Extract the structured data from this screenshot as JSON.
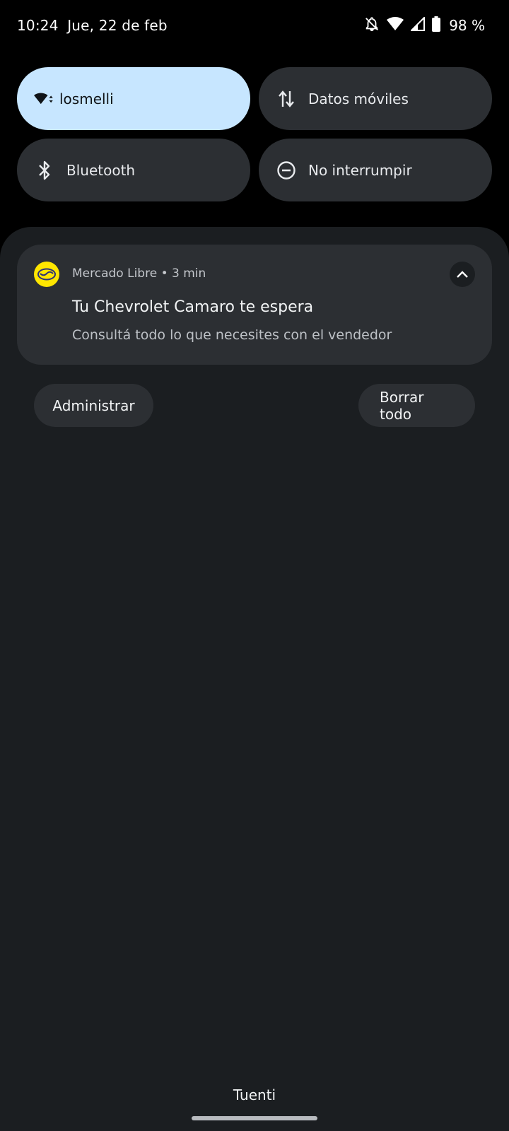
{
  "status_bar": {
    "time": "10:24",
    "date": "Jue, 22 de feb",
    "icons": [
      "notifications-off-icon",
      "wifi-icon",
      "cell-signal-icon",
      "battery-icon"
    ],
    "battery_percent": "98 %"
  },
  "quick_settings": {
    "tiles": [
      {
        "label": "losmelli",
        "icon": "wifi-icon",
        "active": true
      },
      {
        "label": "Datos móviles",
        "icon": "mobile-data-icon",
        "active": false
      },
      {
        "label": "Bluetooth",
        "icon": "bluetooth-icon",
        "active": false
      },
      {
        "label": "No interrumpir",
        "icon": "do-not-disturb-icon",
        "active": false
      }
    ]
  },
  "notification": {
    "app_icon": "mercado-libre-logo",
    "header": "Mercado Libre • 3 min",
    "title": "Tu Chevrolet Camaro te espera",
    "text": "Consultá todo lo que necesites con el vendedor",
    "expand_icon": "chevron-up-icon"
  },
  "actions": {
    "manage_label": "Administrar",
    "clear_all_label": "Borrar todo"
  },
  "footer": {
    "carrier": "Tuenti"
  },
  "colors": {
    "background": "#000000",
    "shade": "#1b1e21",
    "tile": "#2c2f33",
    "tile_active": "#c7e6ff",
    "brand_yellow": "#ffe600"
  }
}
